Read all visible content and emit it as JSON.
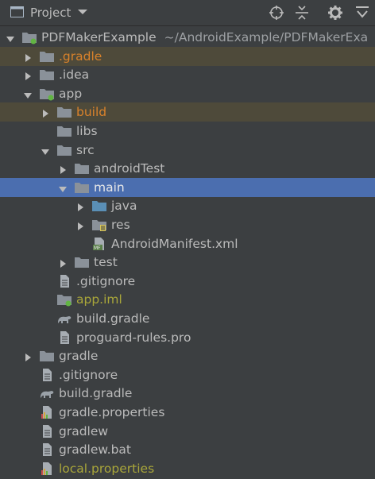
{
  "panel": {
    "title": "Project",
    "buttons": [
      "target-icon",
      "collapse-icon",
      "gear-icon",
      "hide-icon"
    ]
  },
  "tree": [
    {
      "label": "PDFMakerExample",
      "path": "~/AndroidExample/PDFMakerExa",
      "icon": "module-folder-icon",
      "state": "expanded"
    },
    {
      "label": ".gradle",
      "icon": "folder-icon",
      "state": "collapsed",
      "style": "excluded"
    },
    {
      "label": ".idea",
      "icon": "folder-icon",
      "state": "collapsed"
    },
    {
      "label": "app",
      "icon": "module-folder-icon",
      "state": "expanded"
    },
    {
      "label": "build",
      "icon": "folder-icon",
      "state": "collapsed",
      "style": "excluded"
    },
    {
      "label": "libs",
      "icon": "folder-icon",
      "state": "leaf"
    },
    {
      "label": "src",
      "icon": "folder-icon",
      "state": "expanded"
    },
    {
      "label": "androidTest",
      "icon": "folder-icon",
      "state": "collapsed"
    },
    {
      "label": "main",
      "icon": "folder-icon",
      "state": "expanded",
      "style": "selected"
    },
    {
      "label": "java",
      "icon": "source-folder-icon",
      "state": "collapsed"
    },
    {
      "label": "res",
      "icon": "resource-folder-icon",
      "state": "collapsed"
    },
    {
      "label": "AndroidManifest.xml",
      "icon": "manifest-file-icon",
      "state": "leaf"
    },
    {
      "label": "test",
      "icon": "folder-icon",
      "state": "collapsed"
    },
    {
      "label": ".gitignore",
      "icon": "text-file-icon",
      "state": "leaf"
    },
    {
      "label": "app.iml",
      "icon": "iml-file-icon",
      "state": "leaf"
    },
    {
      "label": "build.gradle",
      "icon": "gradle-file-icon",
      "state": "leaf"
    },
    {
      "label": "proguard-rules.pro",
      "icon": "text-file-icon",
      "state": "leaf"
    },
    {
      "label": "gradle",
      "icon": "folder-icon",
      "state": "collapsed"
    },
    {
      "label": ".gitignore",
      "icon": "text-file-icon",
      "state": "leaf"
    },
    {
      "label": "build.gradle",
      "icon": "gradle-file-icon",
      "state": "leaf"
    },
    {
      "label": "gradle.properties",
      "icon": "properties-file-icon",
      "state": "leaf"
    },
    {
      "label": "gradlew",
      "icon": "text-file-icon",
      "state": "leaf"
    },
    {
      "label": "gradlew.bat",
      "icon": "text-file-icon",
      "state": "leaf"
    },
    {
      "label": "local.properties",
      "icon": "properties-file-icon",
      "state": "leaf"
    }
  ],
  "colors": {
    "background": "#3c3f41",
    "selection": "#4b6eaf",
    "excluded_row": "#4e4a3a",
    "excluded_text": "#d9822b",
    "modified_text": "#a9a63a",
    "folder": "#8a9199",
    "source_folder": "#5a8fb6",
    "module_dot": "#62b543"
  }
}
